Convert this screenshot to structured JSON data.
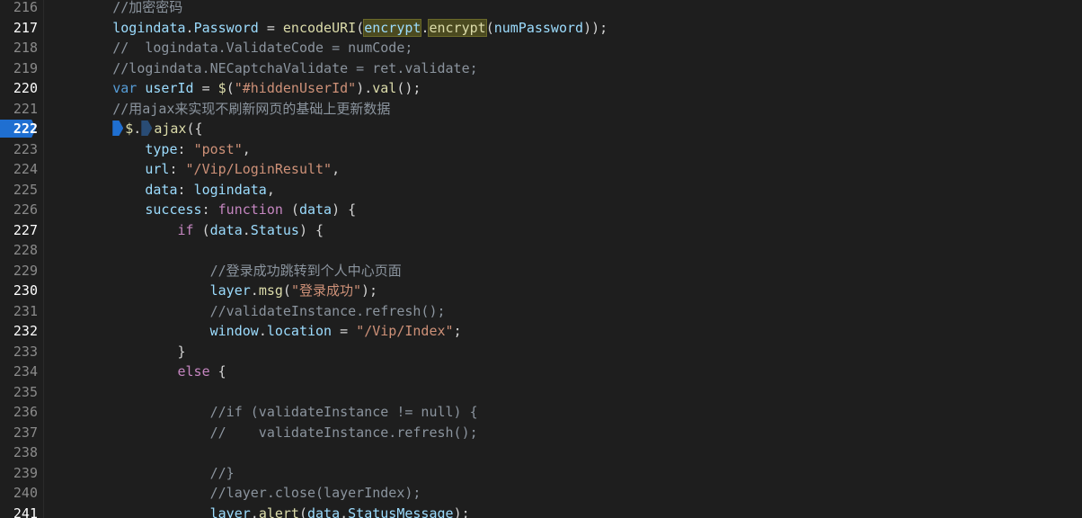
{
  "colors": {
    "background": "#1e1e1e",
    "line_number": "#8a8a8a",
    "line_number_active": "#ffffff",
    "breakpoint": "#1f6fd1",
    "variable": "#9cdcfe",
    "property": "#9cdcfe",
    "method": "#dcdcaa",
    "string": "#ce9178",
    "keyword": "#c586c0",
    "storage": "#569cd6",
    "comment": "#8b949e",
    "punct": "#d4d4d4"
  },
  "editor": {
    "lines": [
      {
        "n": "216",
        "active": false,
        "tokens": [
          {
            "t": "        "
          },
          {
            "t": "//加密密码",
            "c": "comment"
          }
        ]
      },
      {
        "n": "217",
        "active": true,
        "tokens": [
          {
            "t": "        "
          },
          {
            "t": "logindata",
            "c": "variable"
          },
          {
            "t": ".",
            "c": "punct"
          },
          {
            "t": "Password",
            "c": "property"
          },
          {
            "t": " = ",
            "c": "punct"
          },
          {
            "t": "encodeURI",
            "c": "method"
          },
          {
            "t": "(",
            "c": "punct"
          },
          {
            "t": "encrypt",
            "c": "variable",
            "hl": true
          },
          {
            "t": ".",
            "c": "punct"
          },
          {
            "t": "encrypt",
            "c": "method",
            "hl": true
          },
          {
            "t": "(",
            "c": "punct"
          },
          {
            "t": "numPassword",
            "c": "variable"
          },
          {
            "t": "));",
            "c": "punct"
          }
        ]
      },
      {
        "n": "218",
        "active": false,
        "tokens": [
          {
            "t": "        "
          },
          {
            "t": "//  logindata.ValidateCode = numCode;",
            "c": "comment"
          }
        ]
      },
      {
        "n": "219",
        "active": false,
        "tokens": [
          {
            "t": "        "
          },
          {
            "t": "//logindata.NECaptchaValidate = ret.validate;",
            "c": "comment"
          }
        ]
      },
      {
        "n": "220",
        "active": true,
        "tokens": [
          {
            "t": "        "
          },
          {
            "t": "var",
            "c": "storage"
          },
          {
            "t": " "
          },
          {
            "t": "userId",
            "c": "variable"
          },
          {
            "t": " = ",
            "c": "punct"
          },
          {
            "t": "$",
            "c": "method"
          },
          {
            "t": "(",
            "c": "punct"
          },
          {
            "t": "\"#hiddenUserId\"",
            "c": "string"
          },
          {
            "t": ").",
            "c": "punct"
          },
          {
            "t": "val",
            "c": "method"
          },
          {
            "t": "();",
            "c": "punct"
          }
        ]
      },
      {
        "n": "221",
        "active": false,
        "tokens": [
          {
            "t": "        "
          },
          {
            "t": "//用ajax来实现不刷新网页的基础上更新数据",
            "c": "comment"
          }
        ]
      },
      {
        "n": "222",
        "active": true,
        "breakpoint": true,
        "tokens": [
          {
            "t": "        "
          },
          {
            "m": "marker"
          },
          {
            "t": "$",
            "c": "method"
          },
          {
            "t": ".",
            "c": "punct"
          },
          {
            "m": "marker dim"
          },
          {
            "t": "ajax",
            "c": "method"
          },
          {
            "t": "({",
            "c": "punct"
          }
        ]
      },
      {
        "n": "223",
        "active": false,
        "tokens": [
          {
            "t": "            "
          },
          {
            "t": "type",
            "c": "property"
          },
          {
            "t": ": ",
            "c": "punct"
          },
          {
            "t": "\"post\"",
            "c": "string"
          },
          {
            "t": ",",
            "c": "punct"
          }
        ]
      },
      {
        "n": "224",
        "active": false,
        "tokens": [
          {
            "t": "            "
          },
          {
            "t": "url",
            "c": "property"
          },
          {
            "t": ": ",
            "c": "punct"
          },
          {
            "t": "\"/Vip/LoginResult\"",
            "c": "string"
          },
          {
            "t": ",",
            "c": "punct"
          }
        ]
      },
      {
        "n": "225",
        "active": false,
        "tokens": [
          {
            "t": "            "
          },
          {
            "t": "data",
            "c": "property"
          },
          {
            "t": ": ",
            "c": "punct"
          },
          {
            "t": "logindata",
            "c": "variable"
          },
          {
            "t": ",",
            "c": "punct"
          }
        ]
      },
      {
        "n": "226",
        "active": false,
        "tokens": [
          {
            "t": "            "
          },
          {
            "t": "success",
            "c": "property"
          },
          {
            "t": ": ",
            "c": "punct"
          },
          {
            "t": "function",
            "c": "keyword"
          },
          {
            "t": " (",
            "c": "punct"
          },
          {
            "t": "data",
            "c": "variable"
          },
          {
            "t": ") {",
            "c": "punct"
          }
        ]
      },
      {
        "n": "227",
        "active": true,
        "tokens": [
          {
            "t": "                "
          },
          {
            "t": "if",
            "c": "keyword"
          },
          {
            "t": " (",
            "c": "punct"
          },
          {
            "t": "data",
            "c": "variable"
          },
          {
            "t": ".",
            "c": "punct"
          },
          {
            "t": "Status",
            "c": "property"
          },
          {
            "t": ") {",
            "c": "punct"
          }
        ]
      },
      {
        "n": "228",
        "active": false,
        "tokens": []
      },
      {
        "n": "229",
        "active": false,
        "tokens": [
          {
            "t": "                    "
          },
          {
            "t": "//登录成功跳转到个人中心页面",
            "c": "comment"
          }
        ]
      },
      {
        "n": "230",
        "active": true,
        "tokens": [
          {
            "t": "                    "
          },
          {
            "t": "layer",
            "c": "variable"
          },
          {
            "t": ".",
            "c": "punct"
          },
          {
            "t": "msg",
            "c": "method"
          },
          {
            "t": "(",
            "c": "punct"
          },
          {
            "t": "\"登录成功\"",
            "c": "string"
          },
          {
            "t": ");",
            "c": "punct"
          }
        ]
      },
      {
        "n": "231",
        "active": false,
        "tokens": [
          {
            "t": "                    "
          },
          {
            "t": "//validateInstance.refresh();",
            "c": "comment"
          }
        ]
      },
      {
        "n": "232",
        "active": true,
        "tokens": [
          {
            "t": "                    "
          },
          {
            "t": "window",
            "c": "variable"
          },
          {
            "t": ".",
            "c": "punct"
          },
          {
            "t": "location",
            "c": "property"
          },
          {
            "t": " = ",
            "c": "punct"
          },
          {
            "t": "\"/Vip/Index\"",
            "c": "string"
          },
          {
            "t": ";",
            "c": "punct"
          }
        ]
      },
      {
        "n": "233",
        "active": false,
        "tokens": [
          {
            "t": "                "
          },
          {
            "t": "}",
            "c": "punct"
          }
        ]
      },
      {
        "n": "234",
        "active": false,
        "tokens": [
          {
            "t": "                "
          },
          {
            "t": "else",
            "c": "keyword"
          },
          {
            "t": " {",
            "c": "punct"
          }
        ]
      },
      {
        "n": "235",
        "active": false,
        "tokens": []
      },
      {
        "n": "236",
        "active": false,
        "tokens": [
          {
            "t": "                    "
          },
          {
            "t": "//if (validateInstance != null) {",
            "c": "comment"
          }
        ]
      },
      {
        "n": "237",
        "active": false,
        "tokens": [
          {
            "t": "                    "
          },
          {
            "t": "//    validateInstance.refresh();",
            "c": "comment"
          }
        ]
      },
      {
        "n": "238",
        "active": false,
        "tokens": []
      },
      {
        "n": "239",
        "active": false,
        "tokens": [
          {
            "t": "                    "
          },
          {
            "t": "//}",
            "c": "comment"
          }
        ]
      },
      {
        "n": "240",
        "active": false,
        "tokens": [
          {
            "t": "                    "
          },
          {
            "t": "//layer.close(layerIndex);",
            "c": "comment"
          }
        ]
      },
      {
        "n": "241",
        "active": true,
        "tokens": [
          {
            "t": "                    "
          },
          {
            "t": "layer",
            "c": "variable"
          },
          {
            "t": ".",
            "c": "punct"
          },
          {
            "t": "alert",
            "c": "method"
          },
          {
            "t": "(",
            "c": "punct"
          },
          {
            "t": "data",
            "c": "variable"
          },
          {
            "t": ".",
            "c": "punct"
          },
          {
            "t": "StatusMessage",
            "c": "property"
          },
          {
            "t": ");",
            "c": "punct"
          }
        ]
      }
    ]
  }
}
